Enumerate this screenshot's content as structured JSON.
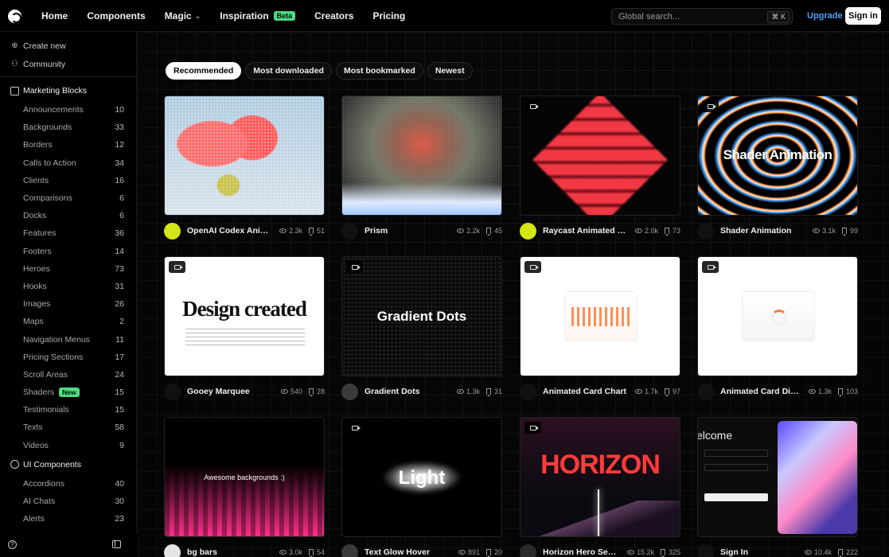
{
  "topbar": {
    "nav": [
      {
        "label": "Home",
        "chevron": false,
        "badge": ""
      },
      {
        "label": "Components",
        "chevron": false,
        "badge": ""
      },
      {
        "label": "Magic",
        "chevron": true,
        "badge": ""
      },
      {
        "label": "Inspiration",
        "chevron": false,
        "badge": "Beta"
      },
      {
        "label": "Creators",
        "chevron": false,
        "badge": ""
      },
      {
        "label": "Pricing",
        "chevron": false,
        "badge": ""
      }
    ],
    "search_placeholder": "Global search...",
    "search_shortcut": "⌘ K",
    "upgrade": "Upgrade",
    "sign_in": "Sign in"
  },
  "sidebar": {
    "top_links": [
      {
        "label": "Create new",
        "icon": "plus-circle-icon"
      },
      {
        "label": "Community",
        "icon": "users-icon"
      }
    ],
    "marketing_title": "Marketing Blocks",
    "marketing_items": [
      {
        "label": "Announcements",
        "count": "10"
      },
      {
        "label": "Backgrounds",
        "count": "33"
      },
      {
        "label": "Borders",
        "count": "12"
      },
      {
        "label": "Calls to Action",
        "count": "34"
      },
      {
        "label": "Clients",
        "count": "16"
      },
      {
        "label": "Comparisons",
        "count": "6"
      },
      {
        "label": "Docks",
        "count": "6"
      },
      {
        "label": "Features",
        "count": "36"
      },
      {
        "label": "Footers",
        "count": "14"
      },
      {
        "label": "Heroes",
        "count": "73"
      },
      {
        "label": "Hooks",
        "count": "31"
      },
      {
        "label": "Images",
        "count": "26"
      },
      {
        "label": "Maps",
        "count": "2"
      },
      {
        "label": "Navigation Menus",
        "count": "11"
      },
      {
        "label": "Pricing Sections",
        "count": "17"
      },
      {
        "label": "Scroll Areas",
        "count": "24"
      },
      {
        "label": "Shaders",
        "count": "15",
        "badge": "New"
      },
      {
        "label": "Testimonials",
        "count": "15"
      },
      {
        "label": "Texts",
        "count": "58"
      },
      {
        "label": "Videos",
        "count": "9"
      }
    ],
    "ui_title": "UI Components",
    "ui_items": [
      {
        "label": "Accordions",
        "count": "40"
      },
      {
        "label": "AI Chats",
        "count": "30"
      },
      {
        "label": "Alerts",
        "count": "23"
      }
    ]
  },
  "filters": [
    "Recommended",
    "Most downloaded",
    "Most bookmarked",
    "Newest"
  ],
  "cards": [
    {
      "name": "OpenAI Codex Animate...",
      "views": "2.3k",
      "bookmarks": "51",
      "video": false,
      "avatar": "#d4e616",
      "thumb_text": ""
    },
    {
      "name": "Prism",
      "views": "2.2k",
      "bookmarks": "45",
      "video": false,
      "avatar": "#111111",
      "thumb_text": ""
    },
    {
      "name": "Raycast Animated Bac...",
      "views": "2.0k",
      "bookmarks": "73",
      "video": true,
      "avatar": "#d4e616",
      "thumb_text": ""
    },
    {
      "name": "Shader Animation",
      "views": "3.1k",
      "bookmarks": "99",
      "video": true,
      "avatar": "#111111",
      "thumb_text": "Shader Animation"
    },
    {
      "name": "Gooey Marquee",
      "views": "540",
      "bookmarks": "28",
      "video": true,
      "avatar": "#111111",
      "thumb_text": "Design created"
    },
    {
      "name": "Gradient Dots",
      "views": "1.3k",
      "bookmarks": "31",
      "video": true,
      "avatar": "#3a3a3a",
      "thumb_text": "Gradient Dots"
    },
    {
      "name": "Animated Card Chart",
      "views": "1.7k",
      "bookmarks": "97",
      "video": true,
      "avatar": "#111111",
      "thumb_text": ""
    },
    {
      "name": "Animated Card Diagram",
      "views": "1.3k",
      "bookmarks": "103",
      "video": true,
      "avatar": "#111111",
      "thumb_text": ""
    },
    {
      "name": "bg bars",
      "views": "3.0k",
      "bookmarks": "54",
      "video": false,
      "avatar": "#e5e5e5",
      "thumb_text": "Awesome backgrounds :)"
    },
    {
      "name": "Text Glow Hover",
      "views": "891",
      "bookmarks": "20",
      "video": true,
      "avatar": "#3a3a3a",
      "thumb_text": "Light"
    },
    {
      "name": "Horizon Hero Section",
      "views": "15.2k",
      "bookmarks": "325",
      "video": true,
      "avatar": "#2a2a2a",
      "thumb_text": "HORIZON"
    },
    {
      "name": "Sign In",
      "views": "10.4k",
      "bookmarks": "222",
      "video": false,
      "avatar": "#111111",
      "thumb_text": "elcome"
    }
  ],
  "colors": {
    "accent_green": "#4ade80",
    "upgrade_blue": "#4aa3ff"
  }
}
